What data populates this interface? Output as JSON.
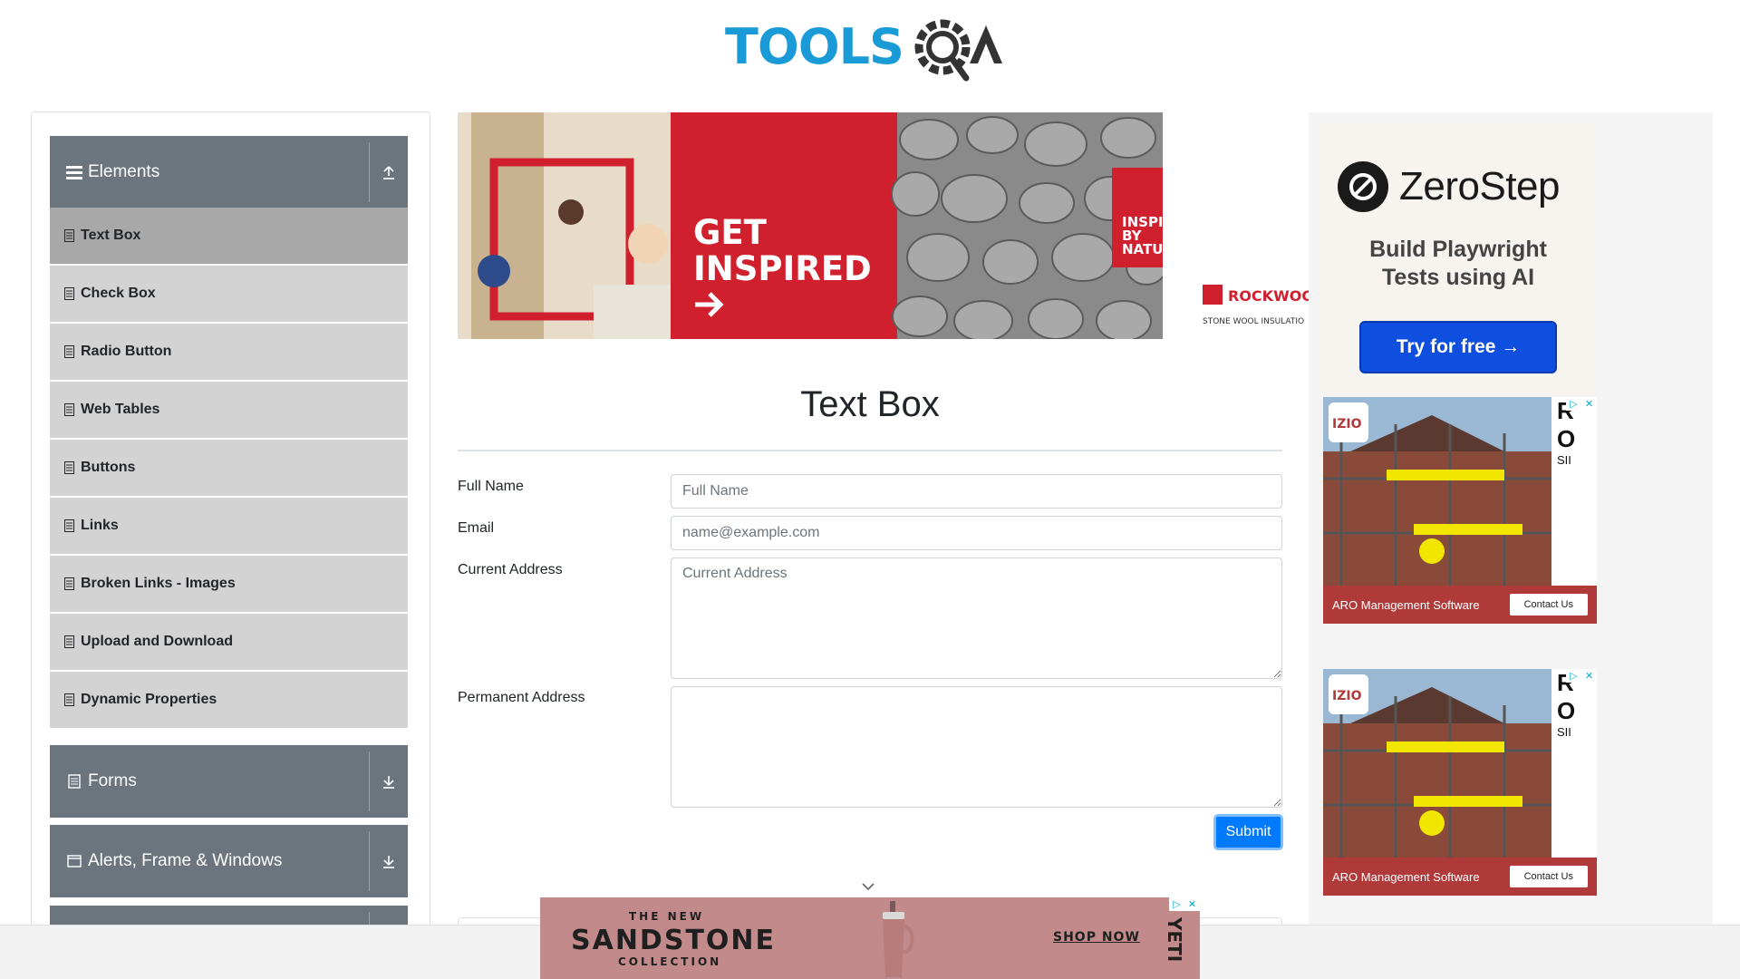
{
  "header": {
    "logo_text_left": "TOOLS",
    "logo_text_right": "QA"
  },
  "sidebar": {
    "groups": [
      {
        "label": "Elements",
        "icon": "hamburger-icon",
        "toggle_icon": "upload-icon"
      },
      {
        "label": "Forms",
        "icon": "document-icon",
        "toggle_icon": "download-icon"
      },
      {
        "label": "Alerts, Frame & Windows",
        "icon": "window-icon",
        "toggle_icon": "download-icon"
      }
    ],
    "items": [
      {
        "label": "Text Box",
        "active": true
      },
      {
        "label": "Check Box"
      },
      {
        "label": "Radio Button"
      },
      {
        "label": "Web Tables"
      },
      {
        "label": "Buttons"
      },
      {
        "label": "Links"
      },
      {
        "label": "Broken Links - Images"
      },
      {
        "label": "Upload and Download"
      },
      {
        "label": "Dynamic Properties"
      }
    ]
  },
  "banner_ad": {
    "headline_1": "GET",
    "headline_2": "INSPIRED",
    "tag_1": "INSPIRED",
    "tag_2": "BY",
    "tag_3": "NATURE.",
    "brand": "ROCKWOO",
    "brand_sub": "STONE WOOL INSULATIO",
    "colors": {
      "red": "#d0202e"
    }
  },
  "main": {
    "title": "Text Box",
    "fields": {
      "full_name_label": "Full Name",
      "full_name_placeholder": "Full Name",
      "email_label": "Email",
      "email_placeholder": "name@example.com",
      "current_address_label": "Current Address",
      "current_address_placeholder": "Current Address",
      "permanent_address_label": "Permanent Address",
      "permanent_address_placeholder": ""
    },
    "submit_label": "Submit"
  },
  "right_ads": {
    "zerostep": {
      "name": "ZeroStep",
      "tagline_1": "Build Playwright",
      "tagline_2": "Tests using AI",
      "cta": "Try for free →"
    },
    "aro": [
      {
        "brand": "IZIO",
        "side_letters": [
          "R",
          "O",
          "SII"
        ],
        "title": "ARO Management Software",
        "cta": "Contact Us"
      },
      {
        "brand": "IZIO",
        "side_letters": [
          "R",
          "O",
          "SII"
        ],
        "title": "ARO Management Software",
        "cta": "Contact Us"
      }
    ]
  },
  "bottom_ad": {
    "line_1": "THE NEW",
    "line_2": "SANDSTONE",
    "line_3": "COLLECTION",
    "cta": "SHOP NOW",
    "brand": "YETI"
  },
  "colors": {
    "sidebar_header": "#6c757d",
    "menu_item": "#d3d3d3",
    "menu_item_active": "#a8a8a8",
    "primary": "#007bff",
    "logo_blue": "#1a9ad6",
    "logo_dark": "#333333"
  }
}
